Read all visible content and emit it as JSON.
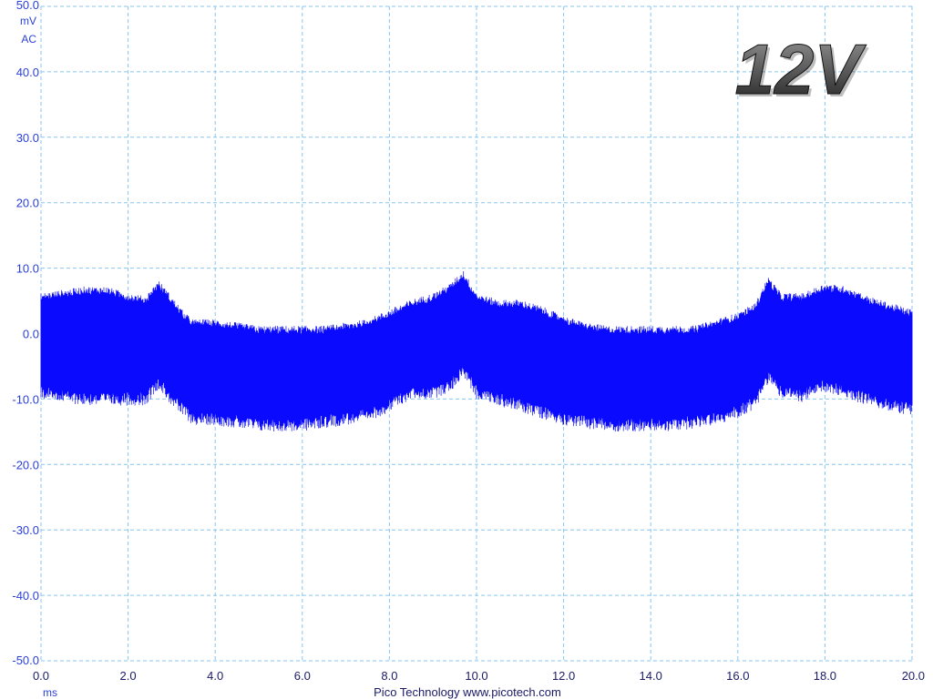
{
  "colors": {
    "trace": "#0a0aff",
    "grid": "#87c6ef",
    "axis_text": "#2a3fd6",
    "badge_light": "#9a9a9a",
    "badge_dark": "#1e1e1e"
  },
  "badge": {
    "text": "12V"
  },
  "footer": {
    "text": "Pico Technology  www.picotech.com"
  },
  "chart_data": {
    "type": "area",
    "y_unit_line1": "mV",
    "y_unit_line2": "AC",
    "x_unit": "ms",
    "xlim": [
      0,
      20
    ],
    "ylim": [
      -50,
      50
    ],
    "grid": true,
    "x_ticks": [
      "0.0",
      "2.0",
      "4.0",
      "6.0",
      "8.0",
      "10.0",
      "12.0",
      "14.0",
      "16.0",
      "18.0",
      "20.0"
    ],
    "y_ticks": [
      "50.0",
      "40.0",
      "30.0",
      "20.0",
      "10.0",
      "0.0",
      "-10.0",
      "-20.0",
      "-30.0",
      "-40.0",
      "-50.0"
    ],
    "series": [
      {
        "x": [
          0.0,
          0.5,
          1.0,
          1.5,
          2.0,
          2.4,
          2.7,
          3.0,
          3.3,
          3.5,
          4.0,
          4.5,
          5.0,
          5.5,
          6.0,
          6.5,
          7.0,
          7.5,
          8.0,
          8.5,
          9.0,
          9.4,
          9.7,
          10.0,
          10.5,
          11.0,
          11.5,
          12.0,
          12.5,
          13.0,
          13.5,
          14.0,
          14.5,
          15.0,
          15.5,
          16.0,
          16.4,
          16.7,
          17.0,
          17.5,
          18.0,
          18.5,
          19.0,
          19.5,
          20.0
        ],
        "upper": [
          5,
          5.5,
          6,
          6,
          5,
          4.5,
          7,
          4.5,
          2,
          1,
          1,
          0.5,
          0,
          0,
          0,
          0,
          0.5,
          1,
          2.5,
          4,
          5,
          6.5,
          8.5,
          5,
          4,
          4,
          3,
          1.5,
          0.5,
          0,
          0,
          0,
          0,
          0,
          1,
          2,
          3.5,
          7.5,
          5,
          5,
          6.5,
          6,
          4.5,
          3.5,
          2.5
        ],
        "lower": [
          -8,
          -8.5,
          -9,
          -9,
          -9,
          -9,
          -6.5,
          -9,
          -11,
          -12,
          -12,
          -12.5,
          -13,
          -13,
          -13,
          -12.5,
          -12,
          -11.5,
          -10,
          -8,
          -8,
          -7,
          -4.5,
          -8,
          -9,
          -10,
          -11,
          -12,
          -12.5,
          -13,
          -13,
          -13,
          -13,
          -12.5,
          -12,
          -11,
          -9.5,
          -5.5,
          -8,
          -8.5,
          -7,
          -8,
          -9,
          -10,
          -10.5
        ]
      }
    ]
  }
}
